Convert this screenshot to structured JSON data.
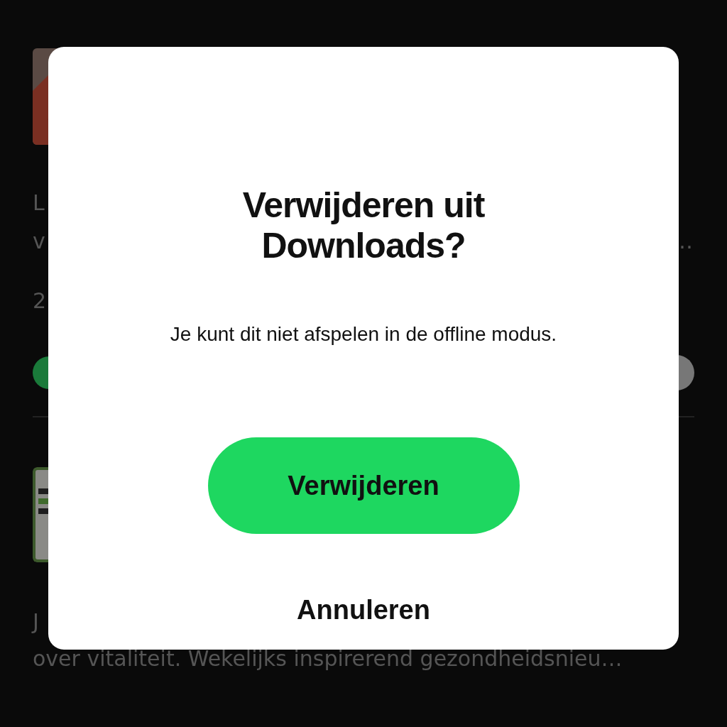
{
  "background": {
    "episodes": [
      {
        "kind": "picture",
        "line_1": "L",
        "line_2": "v",
        "line_2_end": "…",
        "meta": "2",
        "downloaded": true
      },
      {
        "kind": "picture",
        "line_1": "J",
        "line_2": "over vitaliteit. Wekelijks inspirerend gezondheidsnieu…"
      }
    ]
  },
  "dialog": {
    "title": "Verwijderen uit Downloads?",
    "message": "Je kunt dit niet afspelen in de offline modus.",
    "primary_button": "Verwijderen",
    "secondary_button": "Annuleren"
  }
}
